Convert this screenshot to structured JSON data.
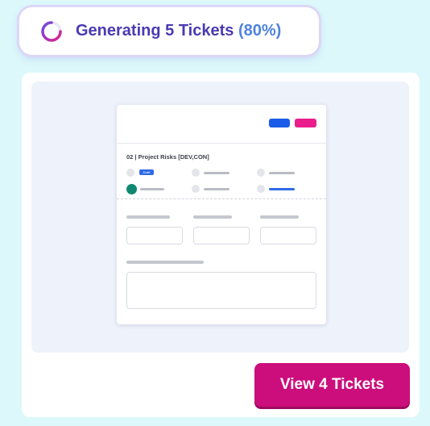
{
  "status": {
    "prefix": "Generating 5 Tickets",
    "percent_label": "(80%)",
    "progress": 0.8,
    "spinner_icon": "loading-spinner-icon"
  },
  "preview": {
    "ticket_title": "02 | Project Risks [DEV,CON]",
    "status_badge": "Draft"
  },
  "actions": {
    "view_button_label": "View 4 Tickets"
  },
  "colors": {
    "accent_purple": "#4a3ab3",
    "percent_blue": "#4f83dd",
    "button_pink": "#cc0d7c",
    "tag_blue": "#1a5be8",
    "tag_pink": "#e91e8c",
    "page_background": "#dcf8fb"
  }
}
